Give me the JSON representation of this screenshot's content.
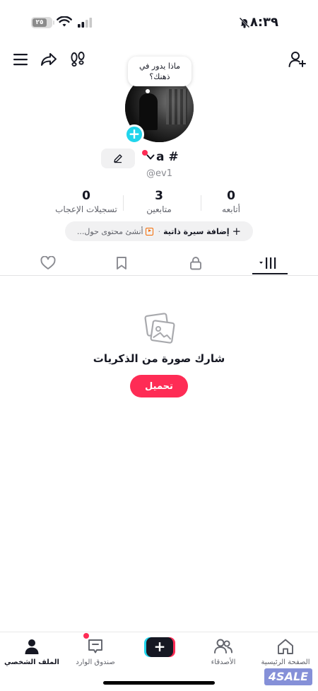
{
  "status_bar": {
    "battery": "٢٥",
    "time": "٨:٣٩",
    "icons": [
      "battery-icon",
      "wifi-icon",
      "signal-icon",
      "bell-off-icon"
    ]
  },
  "top_bar": {
    "icons": [
      "menu-icon",
      "share-icon",
      "footprints-icon",
      "add-user-icon"
    ]
  },
  "profile": {
    "bubble_text": "ماذا يدور في ذهنك؟",
    "name": "a #",
    "handle": "@ev1",
    "stats": [
      {
        "value": "0",
        "label": "أتابعه"
      },
      {
        "value": "3",
        "label": "متابعين"
      },
      {
        "value": "0",
        "label": "تسجيلات الإعجاب"
      }
    ],
    "bio_add": "إضافة سيرة ذاتية",
    "bio_sep": "·",
    "bio_prompt": "أنشئ محتوى حول..."
  },
  "tabs": [
    "videos-grid-icon",
    "lock-icon",
    "bookmark-icon",
    "heart-icon"
  ],
  "empty_state": {
    "title": "شارك صورة من الذكريات",
    "button": "تحميل"
  },
  "bottom_nav": {
    "home": "الصفحة الرئيسية",
    "friends": "الأصدقاء",
    "inbox": "صندوق الوارد",
    "profile": "الملف الشخصي"
  },
  "watermark": "4SALE",
  "colors": {
    "accent": "#fe2c55",
    "cyan": "#20d5ec",
    "text": "#161823"
  }
}
